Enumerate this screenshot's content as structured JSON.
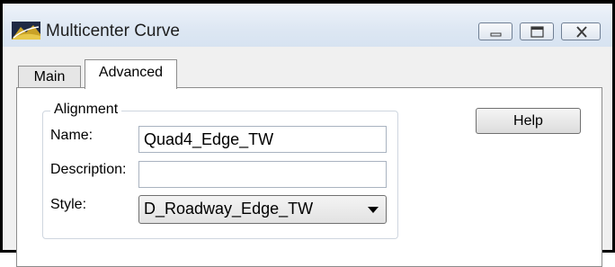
{
  "window": {
    "title": "Multicenter Curve",
    "icon": "multicenter-curve-app-icon",
    "controls": [
      "minimize-icon",
      "maximize-icon",
      "close-icon"
    ]
  },
  "tabs": [
    {
      "label": "Main",
      "selected": false
    },
    {
      "label": "Advanced",
      "selected": true
    }
  ],
  "alignment": {
    "group_label": "Alignment",
    "name_label": "Name:",
    "name_value": "Quad4_Edge_TW",
    "description_label": "Description:",
    "description_value": "",
    "style_label": "Style:",
    "style_value": "D_Roadway_Edge_TW"
  },
  "help_button": "Help"
}
